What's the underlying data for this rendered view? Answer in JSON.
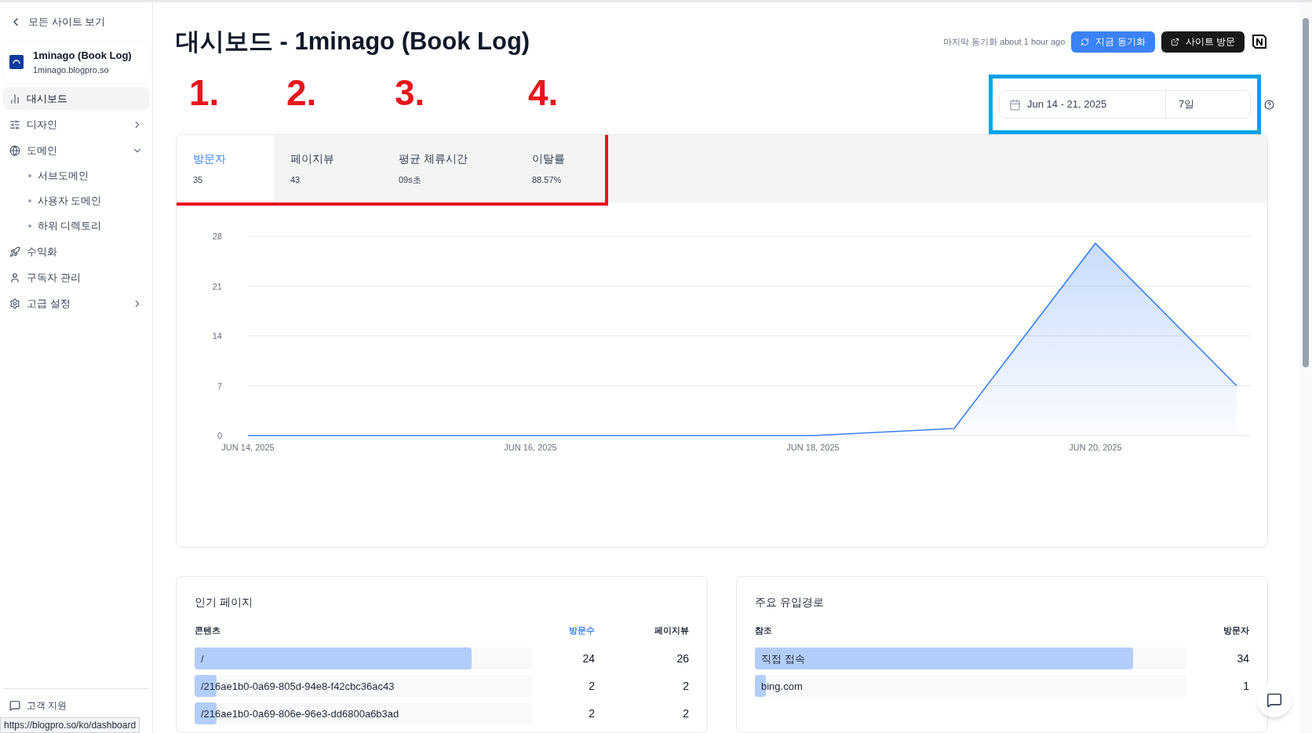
{
  "sidebar": {
    "back_link": "모든 사이트 보기",
    "site": {
      "name": "1minago (Book Log)",
      "domain": "1minago.blogpro.so"
    },
    "items": [
      {
        "label": "대시보드",
        "selected": true
      },
      {
        "label": "디자인",
        "selected": false,
        "expanded": false
      },
      {
        "label": "도메인",
        "selected": false,
        "expanded": true,
        "children": [
          {
            "label": "서브도메인"
          },
          {
            "label": "사용자 도메인"
          },
          {
            "label": "하위 디렉토리"
          }
        ]
      },
      {
        "label": "수익화",
        "selected": false
      },
      {
        "label": "구독자 관리",
        "selected": false
      },
      {
        "label": "고급 설정",
        "selected": false,
        "expanded": false
      }
    ],
    "footer_items": [
      {
        "label": "고객 지원"
      }
    ]
  },
  "status_url": "https://blogpro.so/ko/dashboard",
  "header": {
    "title": "대시보드 - 1minago (Book Log)",
    "last_sync": "마지막 동기화 about 1 hour ago",
    "sync_button": "지금 동기화",
    "visit_button": "사이트 방문"
  },
  "date_range": {
    "range": "Jun 14 - 21, 2025",
    "period": "7일"
  },
  "annotation_numbers": [
    "1.",
    "2.",
    "3.",
    "4."
  ],
  "tabs": [
    {
      "label": "방문자",
      "value": "35",
      "selected": true
    },
    {
      "label": "페이지뷰",
      "value": "43",
      "selected": false
    },
    {
      "label": "평균 체류시간",
      "value": "09s초",
      "selected": false
    },
    {
      "label": "이탈률",
      "value": "88.57%",
      "selected": false
    }
  ],
  "chart_data": {
    "type": "area",
    "categories": [
      "JUN 14, 2025",
      null,
      "JUN 16, 2025",
      null,
      "JUN 18, 2025",
      null,
      "JUN 20, 2025",
      null
    ],
    "series": [
      {
        "color": "#3b82f6",
        "values": [
          0,
          0,
          0,
          0,
          0,
          1,
          27,
          7
        ]
      }
    ],
    "ylim": [
      0,
      28
    ],
    "yticks": [
      0,
      7,
      14,
      21,
      28
    ],
    "grid": true
  },
  "popular_pages": {
    "title": "인기 페이지",
    "columns": [
      "콘텐츠",
      "방문수",
      "페이지뷰"
    ],
    "rows": [
      {
        "path": "/",
        "visits": "24",
        "pageviews": "26",
        "level": 0.82
      },
      {
        "path": "/216ae1b0-0a69-805d-94e8-f42cbc36ac43",
        "visits": "2",
        "pageviews": "2",
        "level": 0.065
      },
      {
        "path": "/216ae1b0-0a69-806e-96e3-dd6800a6b3ad",
        "visits": "2",
        "pageviews": "2",
        "level": 0.065
      }
    ]
  },
  "referrers": {
    "title": "주요 유입경로",
    "columns": [
      "참조",
      "방문자"
    ],
    "rows": [
      {
        "source": "직접 접속",
        "visitors": "34",
        "level": 0.876
      },
      {
        "source": "bing.com",
        "visitors": "1",
        "level": 0.025
      }
    ]
  }
}
